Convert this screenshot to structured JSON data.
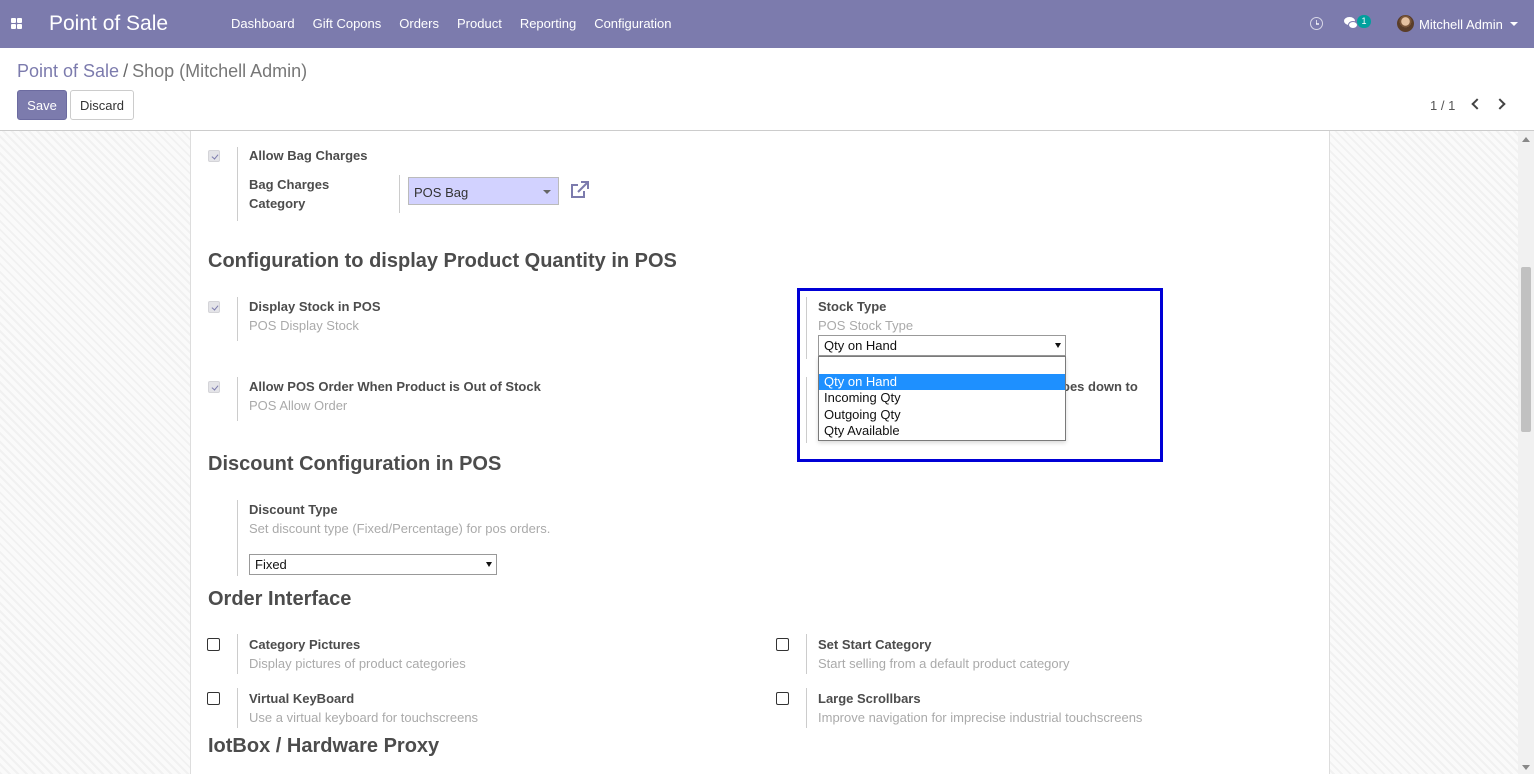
{
  "navbar": {
    "brand": "Point of Sale",
    "menu": [
      "Dashboard",
      "Gift Copons",
      "Orders",
      "Product",
      "Reporting",
      "Configuration"
    ],
    "messages_badge": "1",
    "user_name": "Mitchell Admin",
    "color": "#7c7bad"
  },
  "control_panel": {
    "breadcrumb_root": "Point of Sale",
    "breadcrumb_sep": "/",
    "breadcrumb_current": "Shop (Mitchell Admin)",
    "save_label": "Save",
    "discard_label": "Discard",
    "pager": "1 / 1"
  },
  "bag": {
    "allow_label": "Allow Bag Charges",
    "allow_checked": true,
    "category_label_line1": "Bag Charges",
    "category_label_line2": "Category",
    "category_value": "POS Bag"
  },
  "stock_section": {
    "title": "Configuration to display Product Quantity in POS",
    "display_label": "Display Stock in POS",
    "display_help": "POS Display Stock",
    "display_checked": true,
    "stock_type_label": "Stock Type",
    "stock_type_help": "POS Stock Type",
    "stock_type_value": "Qty on Hand",
    "stock_type_options": [
      "Qty on Hand",
      "Incoming Qty",
      "Outgoing Qty",
      "Qty Available"
    ],
    "stock_type_selected_index": 0,
    "allow_order_label": "Allow POS Order When Product is Out of Stock",
    "allow_order_help": "POS Allow Order",
    "allow_order_checked": true,
    "partial_label": "oes down to"
  },
  "discount_section": {
    "title": "Discount Configuration in POS",
    "type_label": "Discount Type",
    "type_help": "Set discount type (Fixed/Percentage) for pos orders.",
    "type_value": "Fixed"
  },
  "order_interface": {
    "title": "Order Interface",
    "category_pictures_label": "Category Pictures",
    "category_pictures_help": "Display pictures of product categories",
    "start_category_label": "Set Start Category",
    "start_category_help": "Start selling from a default product category",
    "virtual_keyboard_label": "Virtual KeyBoard",
    "virtual_keyboard_help": "Use a virtual keyboard for touchscreens",
    "large_scrollbars_label": "Large Scrollbars",
    "large_scrollbars_help": "Improve navigation for imprecise industrial touchscreens"
  },
  "iot_section": {
    "title": "IotBox / Hardware Proxy"
  }
}
